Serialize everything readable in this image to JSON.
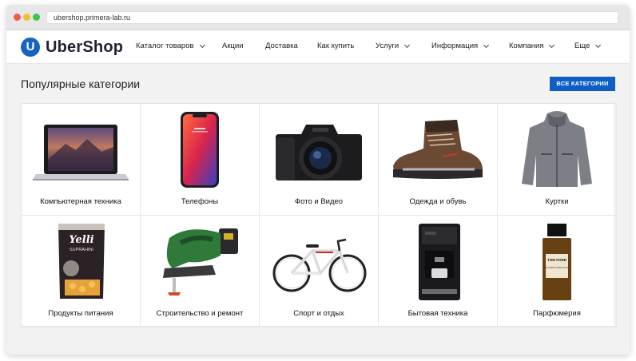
{
  "browser": {
    "url": "ubershop.primera-lab.ru"
  },
  "logo": {
    "letter": "U",
    "text": "UberShop"
  },
  "nav": [
    {
      "label": "Каталог товаров",
      "dropdown": true
    },
    {
      "label": "Акции",
      "dropdown": false
    },
    {
      "label": "Доставка",
      "dropdown": false
    },
    {
      "label": "Как купить",
      "dropdown": false
    },
    {
      "label": "Услуги",
      "dropdown": true
    },
    {
      "label": "Информация",
      "dropdown": true
    },
    {
      "label": "Компания",
      "dropdown": true
    },
    {
      "label": "Еще",
      "dropdown": true
    }
  ],
  "section": {
    "title": "Популярные категории",
    "all_button": "ВСЕ КАТЕГОРИИ"
  },
  "categories": [
    {
      "label": "Компьютерная техника",
      "icon": "laptop-icon"
    },
    {
      "label": "Телефоны",
      "icon": "smartphone-icon"
    },
    {
      "label": "Фото и Видео",
      "icon": "camera-icon"
    },
    {
      "label": "Одежда и обувь",
      "icon": "boot-icon"
    },
    {
      "label": "Куртки",
      "icon": "jacket-icon"
    },
    {
      "label": "Продукты питания",
      "icon": "pasta-pack-icon",
      "package_brand": "Yelli",
      "package_sub": "SUPRAHINI"
    },
    {
      "label": "Строительство и ремонт",
      "icon": "jigsaw-icon"
    },
    {
      "label": "Спорт и отдых",
      "icon": "bicycle-icon"
    },
    {
      "label": "Бытовая техника",
      "icon": "coffee-machine-icon"
    },
    {
      "label": "Парфюмерия",
      "icon": "perfume-icon",
      "bottle_brand": "TOM FORD",
      "bottle_name": "FUCKING FABULOUS"
    }
  ],
  "colors": {
    "accent": "#0f5ec6",
    "logo": "#1565c0",
    "page_bg": "#f2f2f3"
  }
}
